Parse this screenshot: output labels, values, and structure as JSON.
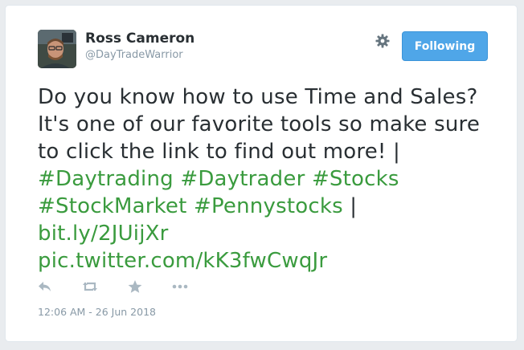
{
  "user": {
    "display_name": "Ross Cameron",
    "handle": "@DayTradeWarrior",
    "avatar_icon": "user-avatar-photo"
  },
  "header": {
    "settings_icon": "gear-icon",
    "follow_label": "Following"
  },
  "tweet": {
    "text_part1": "Do you know how to use Time and Sales? It's one of our favorite tools so make sure to click the link to find out more! | ",
    "hashtag_1": "#Daytrading",
    "hashtag_2": "#Daytrader",
    "hashtag_3": "#Stocks",
    "hashtag_4": "#StockMarket",
    "hashtag_5": "#Pennystocks",
    "separator": " |",
    "link_1": "bit.ly/2JUijXr",
    "link_2": "pic.twitter.com/kK3fwCwqJr"
  },
  "actions": {
    "reply_icon": "reply-icon",
    "retweet_icon": "retweet-icon",
    "favorite_icon": "star-icon",
    "more_icon": "more-icon"
  },
  "timestamp": "12:06 AM - 26 Jun 2018",
  "colors": {
    "link": "#3a9b3e",
    "follow_button": "#4fa6e8",
    "text": "#292f33",
    "muted": "#8899a6"
  }
}
